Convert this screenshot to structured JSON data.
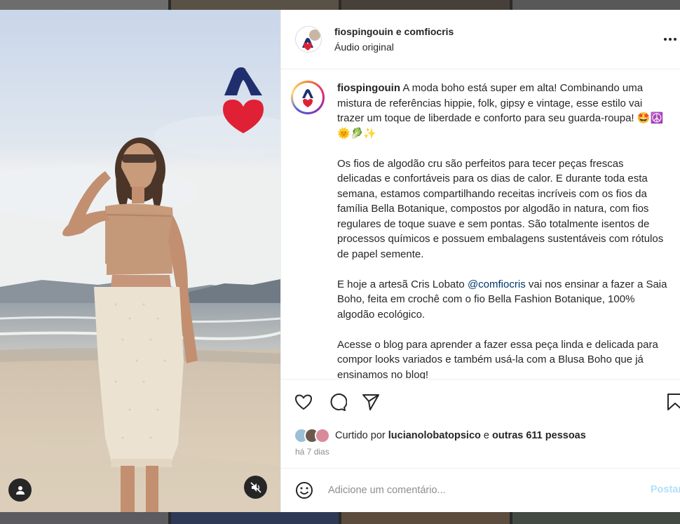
{
  "header": {
    "users": "fiospingouin e comfiocris",
    "audio": "Áudio original",
    "avatar_icon": "penguin-logo-icon",
    "more_icon": "more-options-icon"
  },
  "caption": {
    "username": "fiospingouin",
    "paragraph1": "A moda boho está super em alta! Combinando uma mistura de referências hippie, folk, gipsy e vintage, esse estilo vai trazer um toque de liberdade e conforto para seu guarda-roupa! 🤩☮️🌞🥬✨",
    "paragraph2": "Os fios de algodão cru são perfeitos para tecer peças frescas delicadas e confortáveis para os dias de calor. E durante toda esta semana, estamos compartilhando receitas incríveis com os fios da família Bella Botanique, compostos por algodão in natura, com fios regulares de toque suave e sem pontas. São totalmente isentos de processos químicos e possuem embalagens sustentáveis com rótulos de papel semente.",
    "paragraph3_before": "E hoje a artesã Cris Lobato ",
    "paragraph3_mention": "@comfiocris",
    "paragraph3_after": " vai nos ensinar a fazer a Saia Boho, feita em crochê com o fio Bella Fashion Botanique, 100% algodão ecológico.",
    "paragraph4": "Acesse o blog para aprender a fazer essa peça linda e delicada para compor looks variados e também usá-la com a Blusa Boho que já ensinamos no blog!"
  },
  "actions": {
    "like_icon": "heart-icon",
    "comment_icon": "comment-icon",
    "share_icon": "send-icon",
    "save_icon": "bookmark-icon"
  },
  "likes": {
    "prefix": "Curtido por ",
    "user": "lucianolobatopsico",
    "middle": " e ",
    "others": "outras 611 pessoas"
  },
  "date": "há 7 dias",
  "comment": {
    "placeholder": "Adicione um comentário...",
    "post_label": "Postar",
    "emoji_icon": "emoji-icon"
  },
  "media": {
    "user_tag_icon": "user-tag-icon",
    "mute_icon": "muted-speaker-icon",
    "logo_icon": "penguin-heart-logo-icon"
  },
  "colors": {
    "brand_red": "#e02035",
    "brand_navy": "#1f2f6e",
    "link": "#00376b",
    "post_disabled": "#b2dffc"
  }
}
